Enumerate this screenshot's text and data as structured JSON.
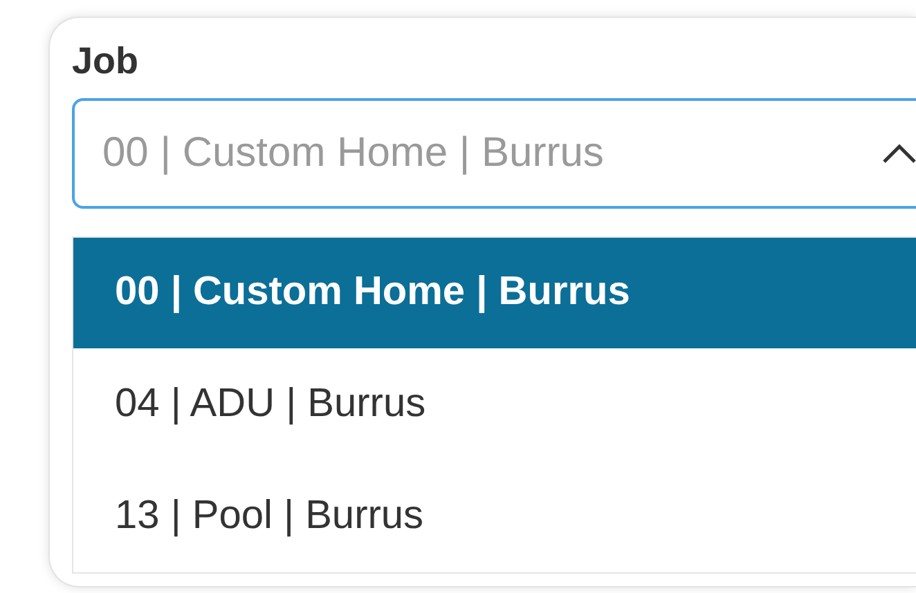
{
  "field": {
    "label": "Job",
    "placeholder": "00 | Custom Home | Burrus",
    "expanded": true
  },
  "options": [
    {
      "label": "00 | Custom Home | Burrus",
      "selected": true
    },
    {
      "label": "04 | ADU | Burrus",
      "selected": false
    },
    {
      "label": "13 | Pool | Burrus",
      "selected": false
    }
  ]
}
